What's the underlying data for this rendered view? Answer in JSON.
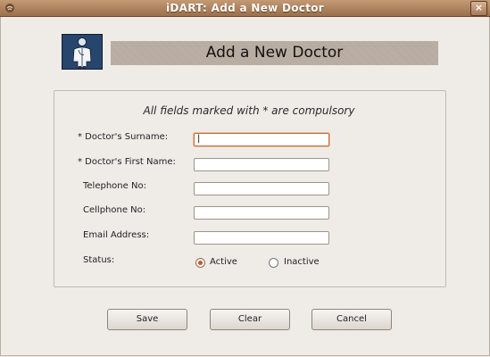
{
  "window": {
    "title": "iDART: Add a New Doctor",
    "close_label": "×"
  },
  "icons": {
    "app_menu": "app-menu-icon",
    "doctor": "doctor-icon"
  },
  "header": {
    "title": "Add a New Doctor"
  },
  "form": {
    "note": "All fields marked with * are compulsory",
    "fields": [
      {
        "label": "* Doctor's Surname:",
        "value": "|",
        "focused": true
      },
      {
        "label": "* Doctor's First Name:",
        "value": ""
      },
      {
        "label": "Telephone No:",
        "value": ""
      },
      {
        "label": "Cellphone No:",
        "value": ""
      },
      {
        "label": "Email Address:",
        "value": ""
      }
    ],
    "status": {
      "label": "Status:",
      "options": [
        {
          "label": "Active",
          "selected": true
        },
        {
          "label": "Inactive",
          "selected": false
        }
      ]
    }
  },
  "buttons": {
    "save": "Save",
    "clear": "Clear",
    "cancel": "Cancel"
  },
  "colors": {
    "titlebar": "#a9805c",
    "background": "#efebe7",
    "focus_border": "#c5703f",
    "radio_selected": "#c35a2a"
  }
}
